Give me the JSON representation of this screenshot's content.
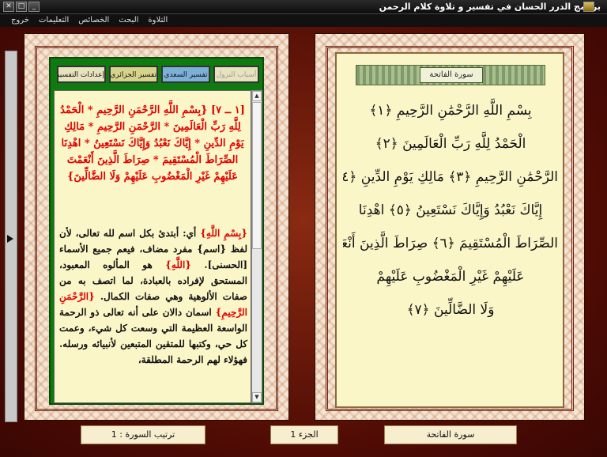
{
  "window": {
    "title": "برنامج الدرر الحسان في تفسير و تلاوة كلام الرحمن"
  },
  "menu": {
    "items": [
      "التلاوة",
      "البحث",
      "الخصائص",
      "التعليمات",
      "خروج"
    ]
  },
  "tafsir": {
    "tabs": {
      "settings": "إعدادات التفسير",
      "jazairi": "تفسير الجزائري",
      "saadi": "تفسير السعدي",
      "nuzul": "أسباب النزول"
    },
    "ayah_text": "[١ ــ ٧] {بِسْمِ اللَّهِ الرَّحْمَنِ الرَّحِيمِ * الْحَمْدُ لِلَّهِ رَبِّ الْعَالَمِينَ * الرَّحْمَنِ الرَّحِيمِ * مَالِكِ يَوْمِ الدِّينِ * إِيَّاكَ نَعْبُدُ وَإِيَّاكَ نَسْتَعِينُ * اهْدِنَا الصِّرَاطَ الْمُسْتَقِيمَ * صِرَاطَ الَّذِينَ أَنْعَمْتَ عَلَيْهِمْ غَيْرِ الْمَغْضُوبِ عَلَيْهِمْ وَلَا الضَّالِّينَ}",
    "para": {
      "h1": "{بِسْمِ اللَّهِ}",
      "t1": " أي: أبتدئ بكل اسم لله تعالى، لأن لفظ {اسم} مفرد مضاف، فيعم جميع الأسماء [الحسنى]. ",
      "h2": "{اللَّهِ}",
      "t2": " هو المألوه المعبود، المستحق لإفراده بالعبادة، لما اتصف به من صفات الألوهية وهي صفات الكمال. ",
      "h3": "{الرَّحْمَنِ الرَّحِيمِ}",
      "t3": " اسمان دالان على أنه تعالى ذو الرحمة الواسعة العظيمة التي وسعت كل شيء، وعمت كل حي، وكتبها للمتقين المتبعين لأنبيائه ورسله. فهؤلاء لهم الرحمة المطلقة،"
    }
  },
  "mushaf": {
    "sura_label": "سورة الفاتحة",
    "lines": [
      "بِسْمِ اللَّهِ الرَّحْمَٰنِ الرَّحِيمِ ﴿١﴾",
      "الْحَمْدُ لِلَّهِ رَبِّ الْعَالَمِينَ ﴿٢﴾",
      "الرَّحْمَٰنِ الرَّحِيمِ ﴿٣﴾ مَالِكِ يَوْمِ الدِّينِ ﴿٤﴾",
      "إِيَّاكَ نَعْبُدُ وَإِيَّاكَ نَسْتَعِينُ ﴿٥﴾ اهْدِنَا",
      "الصِّرَاطَ الْمُسْتَقِيمَ ﴿٦﴾ صِرَاطَ الَّذِينَ أَنْعَمْتَ",
      "عَلَيْهِمْ غَيْرِ الْمَغْضُوبِ عَلَيْهِمْ",
      "وَلَا الضَّالِّينَ ﴿٧﴾"
    ]
  },
  "status": {
    "sura_name": "سورة الفاتحة",
    "juz": "الجزء 1",
    "sura_order": "ترتيب السورة : 1"
  }
}
